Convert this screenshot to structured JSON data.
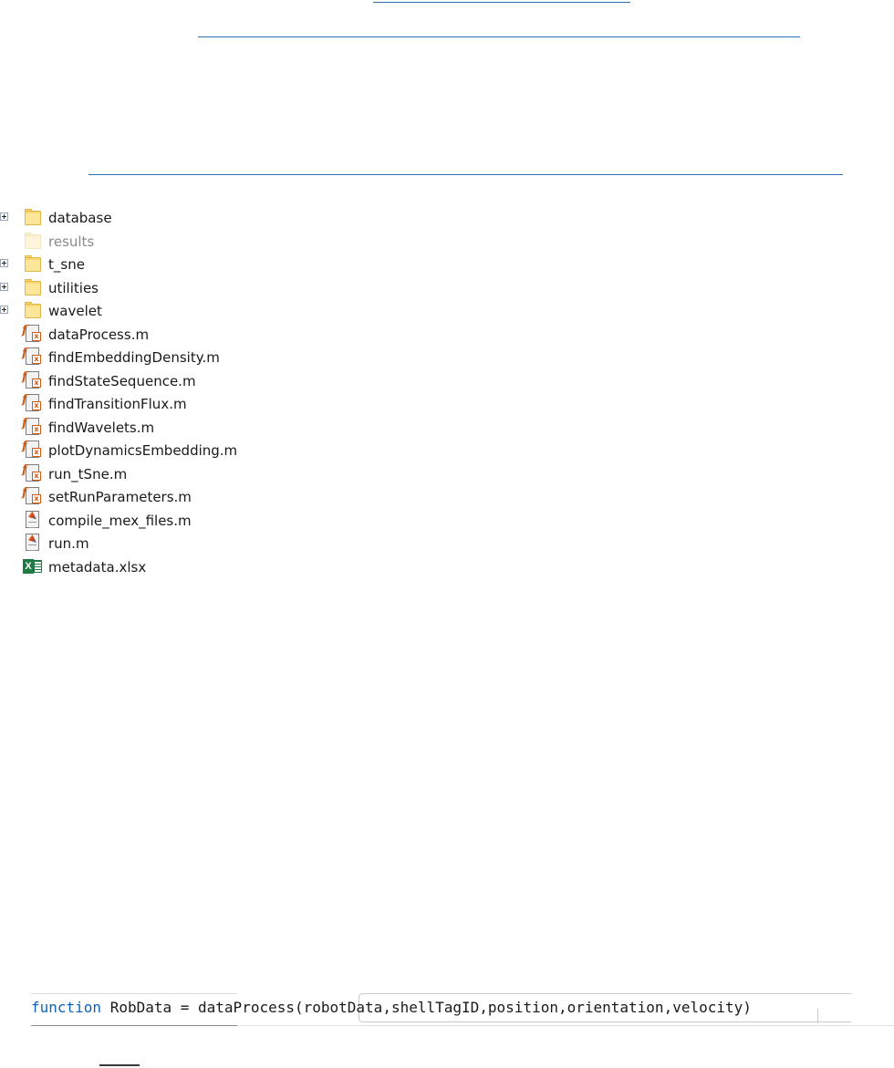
{
  "file_tree": {
    "items": [
      {
        "label": "database",
        "type": "folder",
        "expandable": true,
        "icon": "folder-icon",
        "muted": false
      },
      {
        "label": "results",
        "type": "folder",
        "expandable": false,
        "icon": "folder-icon",
        "muted": true
      },
      {
        "label": "t_sne",
        "type": "folder",
        "expandable": true,
        "icon": "folder-icon",
        "muted": false
      },
      {
        "label": "utilities",
        "type": "folder",
        "expandable": true,
        "icon": "folder-icon",
        "muted": false
      },
      {
        "label": "wavelet",
        "type": "folder",
        "expandable": true,
        "icon": "folder-icon",
        "muted": false
      },
      {
        "label": "dataProcess.m",
        "type": "function",
        "expandable": false,
        "icon": "matlab-function-icon",
        "muted": false
      },
      {
        "label": "findEmbeddingDensity.m",
        "type": "function",
        "expandable": false,
        "icon": "matlab-function-icon",
        "muted": false
      },
      {
        "label": "findStateSequence.m",
        "type": "function",
        "expandable": false,
        "icon": "matlab-function-icon",
        "muted": false
      },
      {
        "label": "findTransitionFlux.m",
        "type": "function",
        "expandable": false,
        "icon": "matlab-function-icon",
        "muted": false
      },
      {
        "label": "findWavelets.m",
        "type": "function",
        "expandable": false,
        "icon": "matlab-function-icon",
        "muted": false
      },
      {
        "label": "plotDynamicsEmbedding.m",
        "type": "function",
        "expandable": false,
        "icon": "matlab-function-icon",
        "muted": false
      },
      {
        "label": "run_tSne.m",
        "type": "function",
        "expandable": false,
        "icon": "matlab-function-icon",
        "muted": false
      },
      {
        "label": "setRunParameters.m",
        "type": "function",
        "expandable": false,
        "icon": "matlab-function-icon",
        "muted": false
      },
      {
        "label": "compile_mex_files.m",
        "type": "script",
        "expandable": false,
        "icon": "matlab-script-icon",
        "muted": false
      },
      {
        "label": "run.m",
        "type": "script",
        "expandable": false,
        "icon": "matlab-script-icon",
        "muted": false
      },
      {
        "label": "metadata.xlsx",
        "type": "excel",
        "expandable": false,
        "icon": "excel-file-icon",
        "muted": false
      }
    ]
  },
  "code": {
    "keyword": "function",
    "signature": " RobData = dataProcess(robotData,shellTagID,position,orientation,velocity)"
  },
  "colors": {
    "link_underline": "#2e6fb0",
    "keyword": "#0e63b8",
    "folder": "#f8d775",
    "excel": "#1d7a44"
  }
}
